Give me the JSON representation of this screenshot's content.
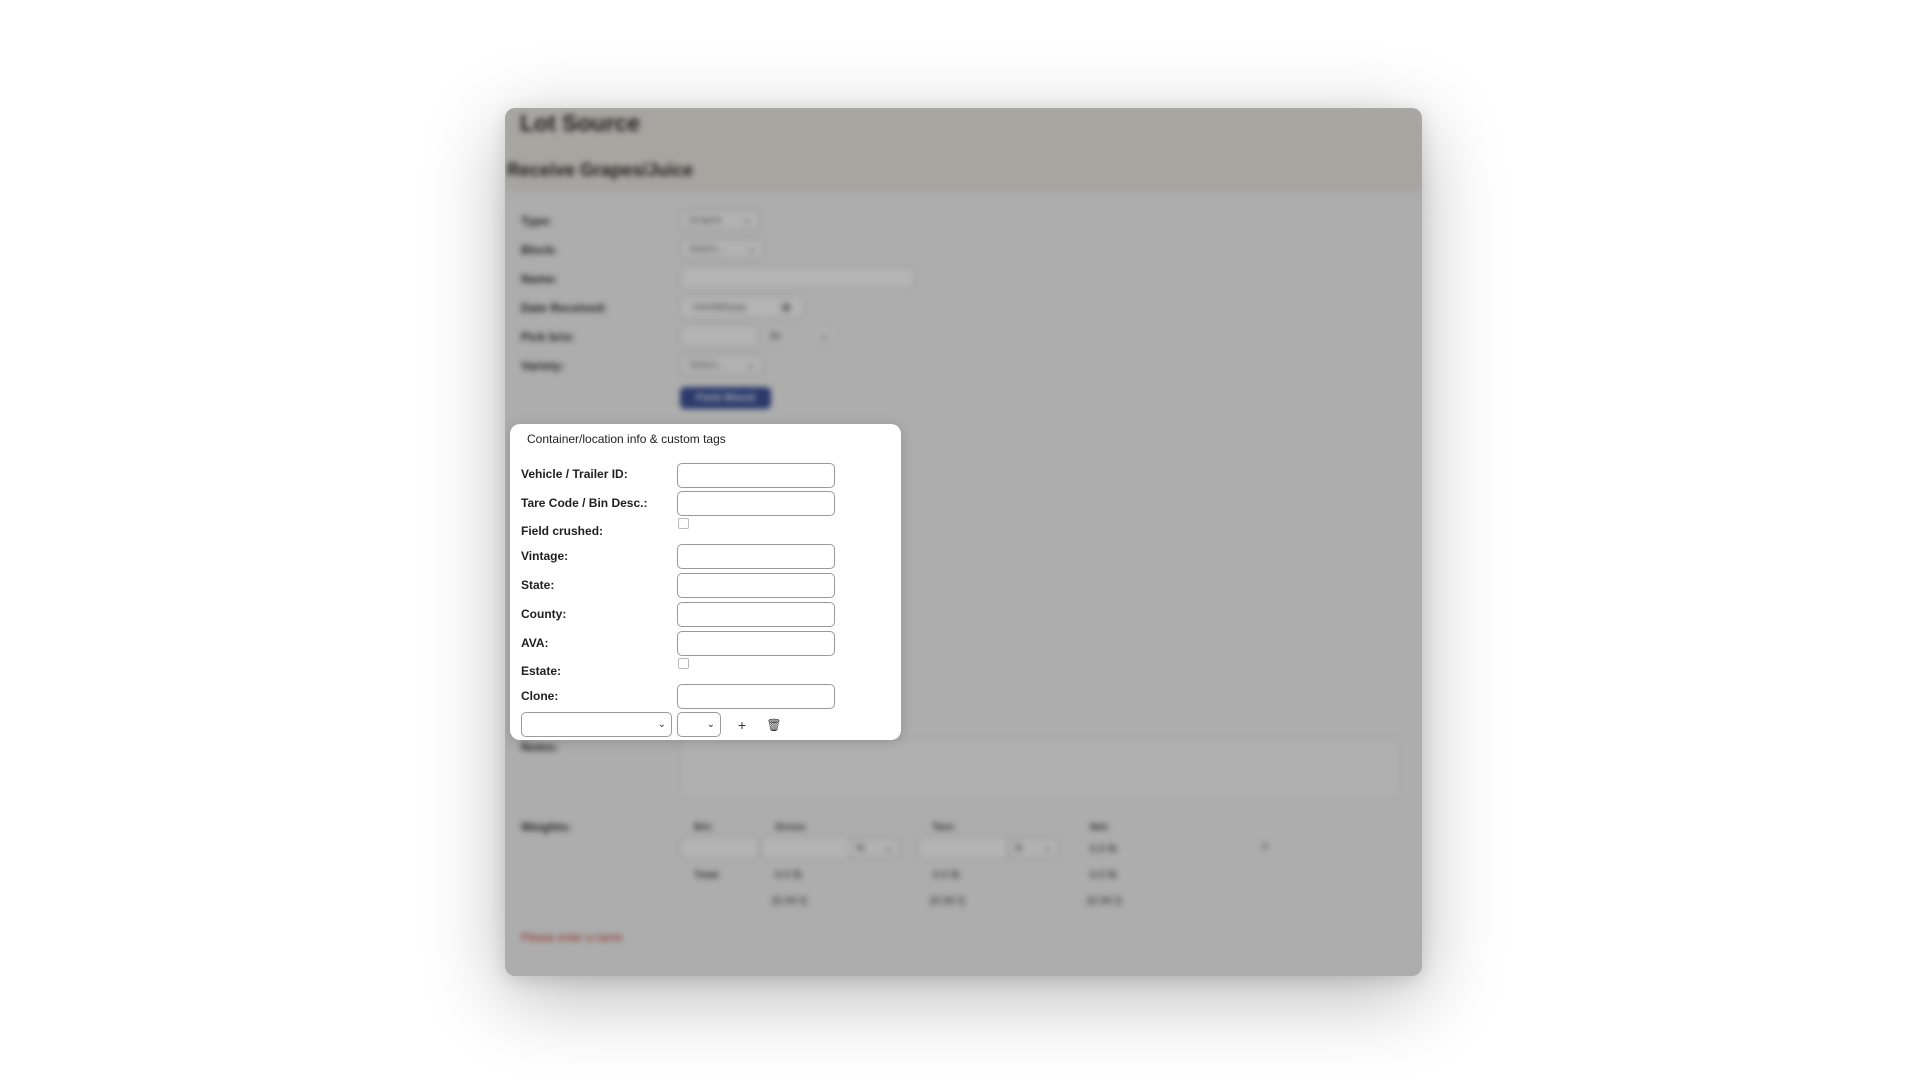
{
  "window": {
    "title": "Lot Source",
    "section": "Receive Grapes/Juice"
  },
  "form": {
    "type": {
      "label": "Type:",
      "value": "Grapes"
    },
    "block": {
      "label": "Block:",
      "value": "Select..."
    },
    "name": {
      "label": "Name:",
      "value": ""
    },
    "date_received": {
      "label": "Date Received:",
      "placeholder": "mm/dd/yyyy"
    },
    "pick_brix": {
      "label": "Pick brix:",
      "unit": "Bx"
    },
    "variety": {
      "label": "Variety:",
      "value": "Select..."
    },
    "field_blend_button": "Field Blend",
    "notes": {
      "label": "Notes:"
    }
  },
  "weights": {
    "label": "Weights:",
    "headers": {
      "bin": "Bin:",
      "gross": "Gross:",
      "tare": "Tare:",
      "net": "Net:"
    },
    "gross_unit": "lb",
    "tare_unit": "lb",
    "row_net": "0.0 lb",
    "total_label": "Total:",
    "totals": {
      "gross": "0.0 lb",
      "tare": "0.0 lb",
      "net": "0.0 lb"
    },
    "tons": {
      "gross": "(0.00 t)",
      "tare": "(0.00 t)",
      "net": "(0.00 t)"
    },
    "remove_symbol": "×"
  },
  "error_text": "Please enter a name",
  "panel": {
    "title": "Container/location info & custom tags",
    "fields": {
      "vehicle": {
        "label": "Vehicle / Trailer ID:",
        "value": ""
      },
      "tare_code": {
        "label": "Tare Code / Bin Desc.:",
        "value": ""
      },
      "field_crushed": {
        "label": "Field crushed:"
      },
      "vintage": {
        "label": "Vintage:",
        "value": ""
      },
      "state": {
        "label": "State:",
        "value": ""
      },
      "county": {
        "label": "County:",
        "value": ""
      },
      "ava": {
        "label": "AVA:",
        "value": ""
      },
      "estate": {
        "label": "Estate:"
      },
      "clone": {
        "label": "Clone:",
        "value": ""
      }
    },
    "add_symbol": "+",
    "delete_symbol": "🗑"
  }
}
